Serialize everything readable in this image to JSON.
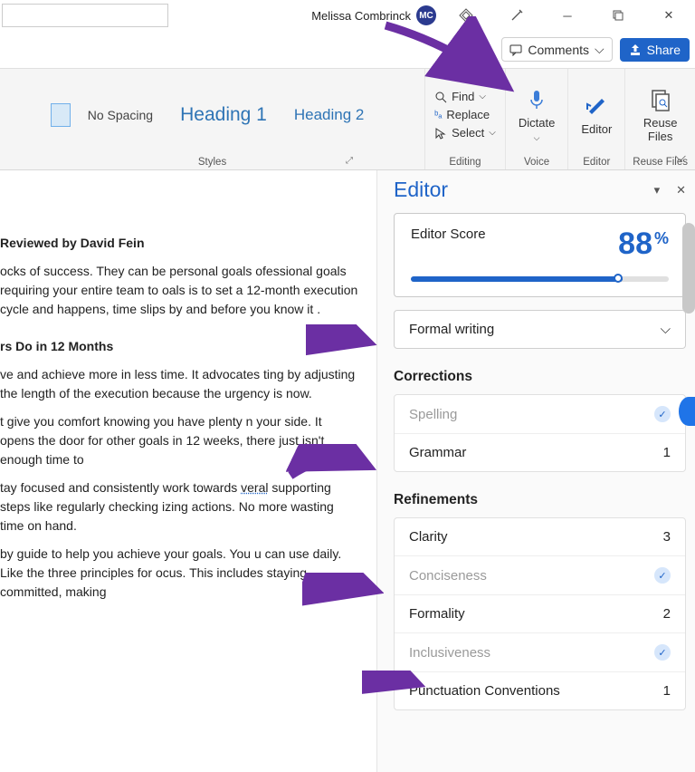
{
  "user": {
    "name": "Melissa Combrinck",
    "initials": "MC"
  },
  "toolbar": {
    "comments": "Comments",
    "share": "Share"
  },
  "ribbon": {
    "styles_label": "Styles",
    "editing_label": "Editing",
    "voice_label": "Voice",
    "editor_label": "Editor",
    "reuse_label": "Reuse Files",
    "styles": {
      "no_spacing": "No Spacing",
      "heading1": "Heading 1",
      "heading2": "Heading 2"
    },
    "editing": {
      "find": "Find",
      "replace": "Replace",
      "select": "Select"
    },
    "dictate": "Dictate",
    "editor": "Editor",
    "reuse": "Reuse\nFiles"
  },
  "document": {
    "byline": "Reviewed by David Fein",
    "p1": "ocks of success. They can be personal goals ofessional goals requiring your entire team to oals is to set a 12-month execution cycle and happens, time slips by and before you know it .",
    "h2": "rs Do in 12 Months",
    "p2": "ve and achieve more in less time. It advocates ting by adjusting the length of the execution because the urgency is now.",
    "p3": "t give you comfort knowing you have plenty n your side. It opens the door for other goals in 12 weeks, there just isn't enough time to",
    "p4": "tay focused and consistently work towards veral supporting steps like regularly checking izing actions. No more wasting time on hand.",
    "p5": "by guide to help you achieve your goals. You u can use daily. Like the three principles for ocus. This includes staying committed, making"
  },
  "pane": {
    "title": "Editor",
    "score_label": "Editor Score",
    "score_value": "88",
    "score_pct": "%",
    "writing_style": "Formal writing",
    "corrections_title": "Corrections",
    "refinements_title": "Refinements",
    "items": {
      "spelling": {
        "label": "Spelling",
        "count": null,
        "done": true
      },
      "grammar": {
        "label": "Grammar",
        "count": "1",
        "done": false
      },
      "clarity": {
        "label": "Clarity",
        "count": "3",
        "done": false
      },
      "conciseness": {
        "label": "Conciseness",
        "count": null,
        "done": true
      },
      "formality": {
        "label": "Formality",
        "count": "2",
        "done": false
      },
      "inclusiveness": {
        "label": "Inclusiveness",
        "count": null,
        "done": true
      },
      "punctuation": {
        "label": "Punctuation Conventions",
        "count": "1",
        "done": false
      }
    }
  },
  "colors": {
    "accent": "#1f64c8",
    "purple": "#6b2fa3"
  }
}
